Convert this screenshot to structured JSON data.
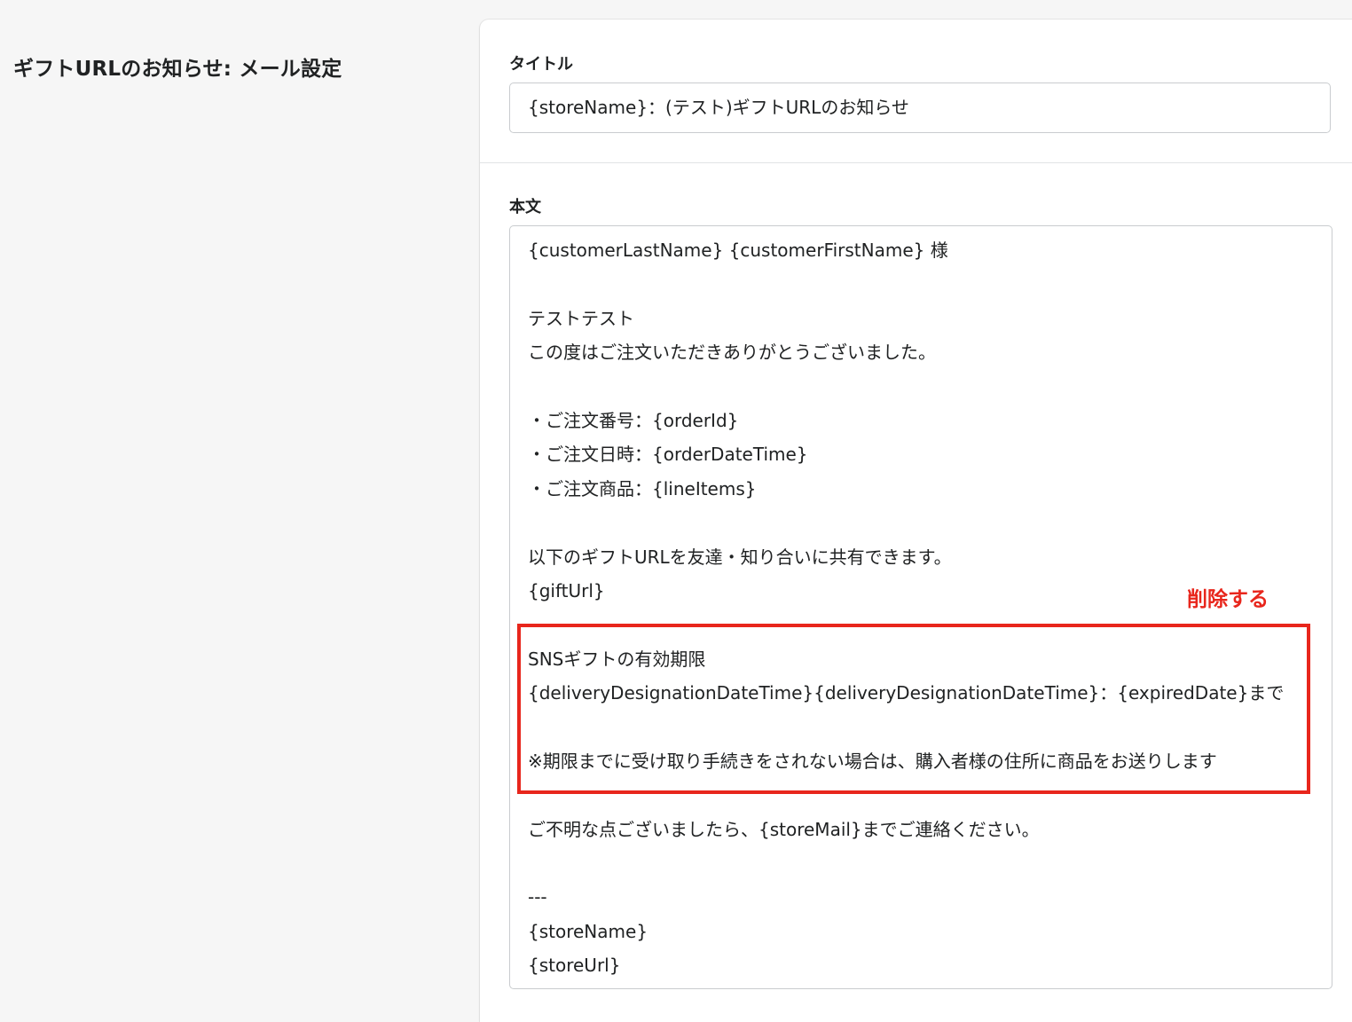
{
  "section": {
    "title": "ギフトURLのお知らせ: メール設定"
  },
  "form": {
    "title_label": "タイトル",
    "title_value": "{storeName}：(テスト)ギフトURLのお知らせ",
    "body_label": "本文",
    "body_lines": [
      "{customerLastName} {customerFirstName} 様",
      "",
      "テストテスト",
      "この度はご注文いただきありがとうございました。",
      "",
      "・ご注文番号：{orderId}",
      "・ご注文日時：{orderDateTime}",
      "・ご注文商品：{lineItems}",
      "",
      "以下のギフトURLを友達・知り合いに共有できます。",
      "{giftUrl}",
      "",
      "SNSギフトの有効期限",
      "{deliveryDesignationDateTime}{deliveryDesignationDateTime}：{expiredDate}まで",
      "",
      "※期限までに受け取り手続きをされない場合は、購入者様の住所に商品をお送りします",
      "",
      "ご不明な点ございましたら、{storeMail}までご連絡ください。",
      "",
      "---",
      "{storeName}",
      "{storeUrl}"
    ]
  },
  "annotation": {
    "label": "削除する",
    "color": "#e8261c"
  }
}
